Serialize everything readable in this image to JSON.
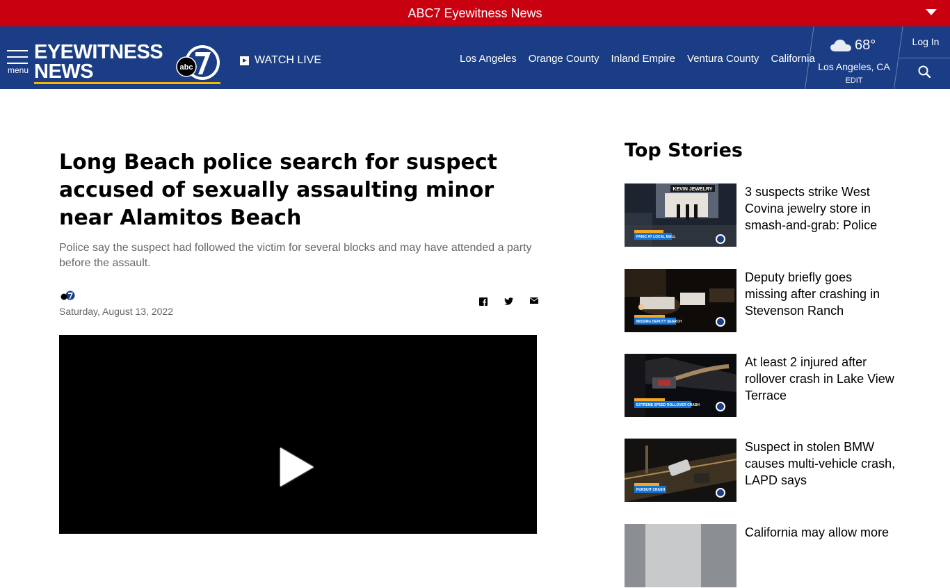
{
  "banner": {
    "title": "ABC7 Eyewitness News"
  },
  "nav": {
    "menu_label": "menu",
    "logo_line1": "EYEWITNESS",
    "logo_line2": "NEWS",
    "watch_live": "WATCH LIVE",
    "locations": [
      "Los Angeles",
      "Orange County",
      "Inland Empire",
      "Ventura County",
      "California"
    ],
    "weather": {
      "temp": "68°",
      "city": "Los Angeles, CA",
      "edit": "EDIT",
      "icon": "cloud-icon"
    },
    "login": "Log In"
  },
  "article": {
    "headline": "Long Beach police search for suspect accused of sexually assaulting minor near Alamitos Beach",
    "dek": "Police say the suspect had followed the victim for several blocks and may have attended a party before the assault.",
    "date": "Saturday, August 13, 2022"
  },
  "top_stories": {
    "title": "Top Stories",
    "items": [
      {
        "title": "3 suspects strike West Covina jewelry store in smash-and-grab: Police",
        "thumb_caption": "PANIC AT LOCAL MALL",
        "colors": [
          "#1d2430",
          "#5a6474",
          "#e7e3dc"
        ]
      },
      {
        "title": "Deputy briefly goes missing after crashing in Stevenson Ranch",
        "thumb_caption": "MISSING DEPUTY SEARCH",
        "colors": [
          "#0e0b08",
          "#3b2a1a",
          "#d9b389"
        ]
      },
      {
        "title": "At least 2 injured after rollover crash in Lake View Terrace",
        "thumb_caption": "EXTREME SPEED ROLLOVER CRASH",
        "colors": [
          "#0b0c10",
          "#3a3838",
          "#c7a36f"
        ]
      },
      {
        "title": "Suspect in stolen BMW causes multi-vehicle crash, LAPD says",
        "thumb_caption": "PURSUIT CRASH",
        "colors": [
          "#141210",
          "#5a4a30",
          "#b08a4e"
        ]
      },
      {
        "title": "California may allow more",
        "thumb_caption": "",
        "colors": [
          "#8b8f93",
          "#c7c9cb",
          "#e4e5e6"
        ]
      }
    ]
  },
  "colors": {
    "banner": "#c9000f",
    "nav": "#1a3d85",
    "logo_underline": "#f7b500"
  }
}
